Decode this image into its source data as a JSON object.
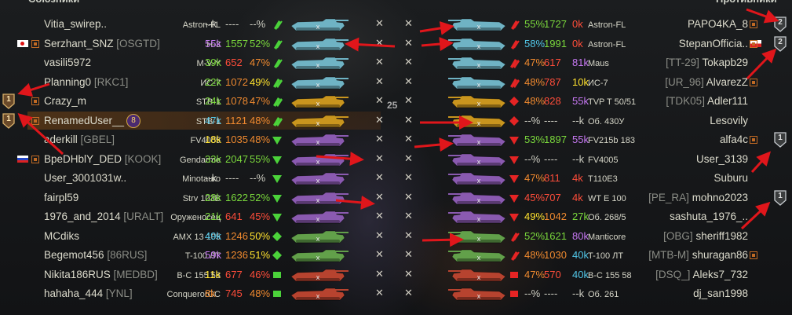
{
  "left_header": "Союзники",
  "right_header": "Противники",
  "center_badge": "25",
  "left_players": [
    {
      "name": "Vitia_swirep..",
      "clan": "",
      "flag": "",
      "platoon": "",
      "vehicle": "Astron-FL",
      "dmg": "--k",
      "battles": "----",
      "wr": "--%",
      "class": "lt",
      "tank_color": "blue",
      "destroyed": false
    },
    {
      "name": "Serzhant_SNZ",
      "clan": "[OSGTD]",
      "flag": "jp",
      "platoon": "1",
      "vehicle": "H-3",
      "dmg": "55k",
      "battles": "1557",
      "wr": "52%",
      "class": "lt",
      "tank_color": "blue",
      "destroyed": false
    },
    {
      "name": "vasili5972",
      "clan": "",
      "flag": "",
      "platoon": "",
      "vehicle": "M-V-Y",
      "dmg": "39k",
      "battles": "652",
      "wr": "47%",
      "class": "lt",
      "tank_color": "blue",
      "destroyed": false
    },
    {
      "name": "Planning0",
      "clan": "[RKC1]",
      "flag": "",
      "platoon": "",
      "vehicle": "ИС-7",
      "dmg": "22k",
      "battles": "1072",
      "wr": "49%",
      "class": "ht",
      "tank_color": "blue",
      "destroyed": false
    },
    {
      "name": "Crazy_m",
      "clan": "",
      "flag": "",
      "platoon": "2",
      "vehicle": "STB-1",
      "dmg": "24k",
      "battles": "1078",
      "wr": "47%",
      "class": "ht",
      "tank_color": "gold",
      "destroyed": false
    },
    {
      "name": "RenamedUser__",
      "clan": "",
      "flag": "",
      "platoon": "2",
      "vehicle": "STB-1",
      "dmg": "47k",
      "battles": "1121",
      "wr": "48%",
      "class": "ht",
      "tank_color": "gold",
      "destroyed": false,
      "badge": "8"
    },
    {
      "name": "aderkill",
      "clan": "[GBEL]",
      "flag": "",
      "platoon": "",
      "vehicle": "FV4005",
      "dmg": "18k",
      "battles": "1035",
      "wr": "48%",
      "class": "td",
      "tank_color": "purple",
      "destroyed": false
    },
    {
      "name": "BpeDHblY_DED",
      "clan": "[KOOK]",
      "flag": "ru",
      "platoon": "3",
      "vehicle": "Gendarme",
      "dmg": "33k",
      "battles": "2047",
      "wr": "55%",
      "class": "td",
      "tank_color": "purple",
      "destroyed": false
    },
    {
      "name": "User_3001031w..",
      "clan": "",
      "flag": "",
      "platoon": "",
      "vehicle": "Minotauro",
      "dmg": "--k",
      "battles": "----",
      "wr": "--%",
      "class": "td",
      "tank_color": "purple",
      "destroyed": false
    },
    {
      "name": "fairpl59",
      "clan": "",
      "flag": "",
      "platoon": "",
      "vehicle": "Strv 103B",
      "dmg": "28k",
      "battles": "1622",
      "wr": "52%",
      "class": "td",
      "tank_color": "purple",
      "destroyed": false
    },
    {
      "name": "1976_and_2014",
      "clan": "[URALT]",
      "flag": "",
      "platoon": "",
      "vehicle": "Оруженосец",
      "dmg": "21k",
      "battles": "641",
      "wr": "45%",
      "class": "td",
      "tank_color": "purple",
      "destroyed": false
    },
    {
      "name": "MCdiks",
      "clan": "",
      "flag": "",
      "platoon": "",
      "vehicle": "AMX 13 105",
      "dmg": "49k",
      "battles": "1246",
      "wr": "50%",
      "class": "mt",
      "tank_color": "green",
      "destroyed": false
    },
    {
      "name": "Begemot456",
      "clan": "[86RUS]",
      "flag": "",
      "platoon": "",
      "vehicle": "T-100 ЛТ",
      "dmg": "59k",
      "battles": "1236",
      "wr": "51%",
      "class": "mt",
      "tank_color": "green",
      "destroyed": false
    },
    {
      "name": "Nikita186RUS",
      "clan": "[MEDBD]",
      "flag": "",
      "platoon": "",
      "vehicle": "B-C 155 58",
      "dmg": "11k",
      "battles": "677",
      "wr": "46%",
      "class": "spg",
      "tank_color": "red",
      "destroyed": false
    },
    {
      "name": "hahaha_444",
      "clan": "[YNL]",
      "flag": "",
      "platoon": "",
      "vehicle": "ConquerorGC",
      "dmg": "8k",
      "battles": "745",
      "wr": "48%",
      "class": "spg",
      "tank_color": "red",
      "destroyed": false
    }
  ],
  "right_players": [
    {
      "name": "PAPO4KA_8",
      "clan": "",
      "flag": "",
      "platoon": "1",
      "vehicle": "Astron-FL",
      "dmg": "0k",
      "battles": "1727",
      "wr": "55%",
      "class": "lt",
      "tank_color": "blue",
      "medal": "2"
    },
    {
      "name": "StepanOfficia..",
      "clan": "",
      "flag": "pl",
      "platoon": "1",
      "vehicle": "Astron-FL",
      "dmg": "0k",
      "battles": "1991",
      "wr": "58%",
      "class": "lt",
      "tank_color": "blue",
      "medal": "2"
    },
    {
      "name": "Tokapb29",
      "clan": "[TT-29]",
      "flag": "",
      "platoon": "",
      "vehicle": "Maus",
      "dmg": "81k",
      "battles": "617",
      "wr": "47%",
      "class": "ht",
      "tank_color": "blue"
    },
    {
      "name": "AlvarezZ",
      "clan": "[UR_96]",
      "flag": "",
      "platoon": "2",
      "vehicle": "ИС-7",
      "dmg": "10k",
      "battles": "787",
      "wr": "48%",
      "class": "ht",
      "tank_color": "blue"
    },
    {
      "name": "Adler111",
      "clan": "[TDK05]",
      "flag": "",
      "platoon": "",
      "vehicle": "TVP T 50/51",
      "dmg": "55k",
      "battles": "828",
      "wr": "48%",
      "class": "mt",
      "tank_color": "gold"
    },
    {
      "name": "Lesovily",
      "clan": "",
      "flag": "",
      "platoon": "",
      "vehicle": "Об. 430У",
      "dmg": "--k",
      "battles": "----",
      "wr": "--%",
      "class": "mt",
      "tank_color": "gold"
    },
    {
      "name": "alfa4c",
      "clan": "",
      "flag": "",
      "platoon": "3",
      "vehicle": "FV215b 183",
      "dmg": "55k",
      "battles": "1897",
      "wr": "53%",
      "class": "td",
      "tank_color": "purple",
      "medal": "1"
    },
    {
      "name": "User_3139",
      "clan": "",
      "flag": "",
      "platoon": "",
      "vehicle": "FV4005",
      "dmg": "--k",
      "battles": "----",
      "wr": "--%",
      "class": "td",
      "tank_color": "purple"
    },
    {
      "name": "Suburu",
      "clan": "",
      "flag": "",
      "platoon": "",
      "vehicle": "T110E3",
      "dmg": "4k",
      "battles": "811",
      "wr": "47%",
      "class": "td",
      "tank_color": "purple"
    },
    {
      "name": "mohno2023",
      "clan": "[PE_RA]",
      "flag": "",
      "platoon": "",
      "vehicle": "WT E 100",
      "dmg": "4k",
      "battles": "707",
      "wr": "45%",
      "class": "td",
      "tank_color": "purple",
      "medal": "1"
    },
    {
      "name": "sashuta_1976_..",
      "clan": "",
      "flag": "",
      "platoon": "",
      "vehicle": "Об. 268/5",
      "dmg": "27k",
      "battles": "1042",
      "wr": "49%",
      "class": "td",
      "tank_color": "purple"
    },
    {
      "name": "sheriff1982",
      "clan": "[OBG]",
      "flag": "",
      "platoon": "",
      "vehicle": "Manticore",
      "dmg": "80k",
      "battles": "1621",
      "wr": "52%",
      "class": "lt",
      "tank_color": "green"
    },
    {
      "name": "shuragan86",
      "clan": "[MTB-M]",
      "flag": "",
      "platoon": "4",
      "vehicle": "T-100 ЛТ",
      "dmg": "40k",
      "battles": "1030",
      "wr": "48%",
      "class": "lt",
      "tank_color": "green"
    },
    {
      "name": "Aleks7_732",
      "clan": "[DSQ_]",
      "flag": "",
      "platoon": "",
      "vehicle": "B-C 155 58",
      "dmg": "40k",
      "battles": "570",
      "wr": "47%",
      "class": "spg",
      "tank_color": "red"
    },
    {
      "name": "dj_san1998",
      "clan": "",
      "flag": "",
      "platoon": "",
      "vehicle": "Об. 261",
      "dmg": "--k",
      "battles": "----",
      "wr": "--%",
      "class": "spg",
      "tank_color": "red"
    }
  ],
  "left_side_medals": [
    {
      "row": 4,
      "label": "1"
    },
    {
      "row": 5,
      "label": "1"
    }
  ],
  "colors": {
    "annotation_arrow": "#e0161b",
    "tank_blue": "#6fb3c4",
    "tank_gold": "#c9951e",
    "tank_purple": "#8a5ab0",
    "tank_green": "#62a04a",
    "tank_red": "#b7432f"
  }
}
